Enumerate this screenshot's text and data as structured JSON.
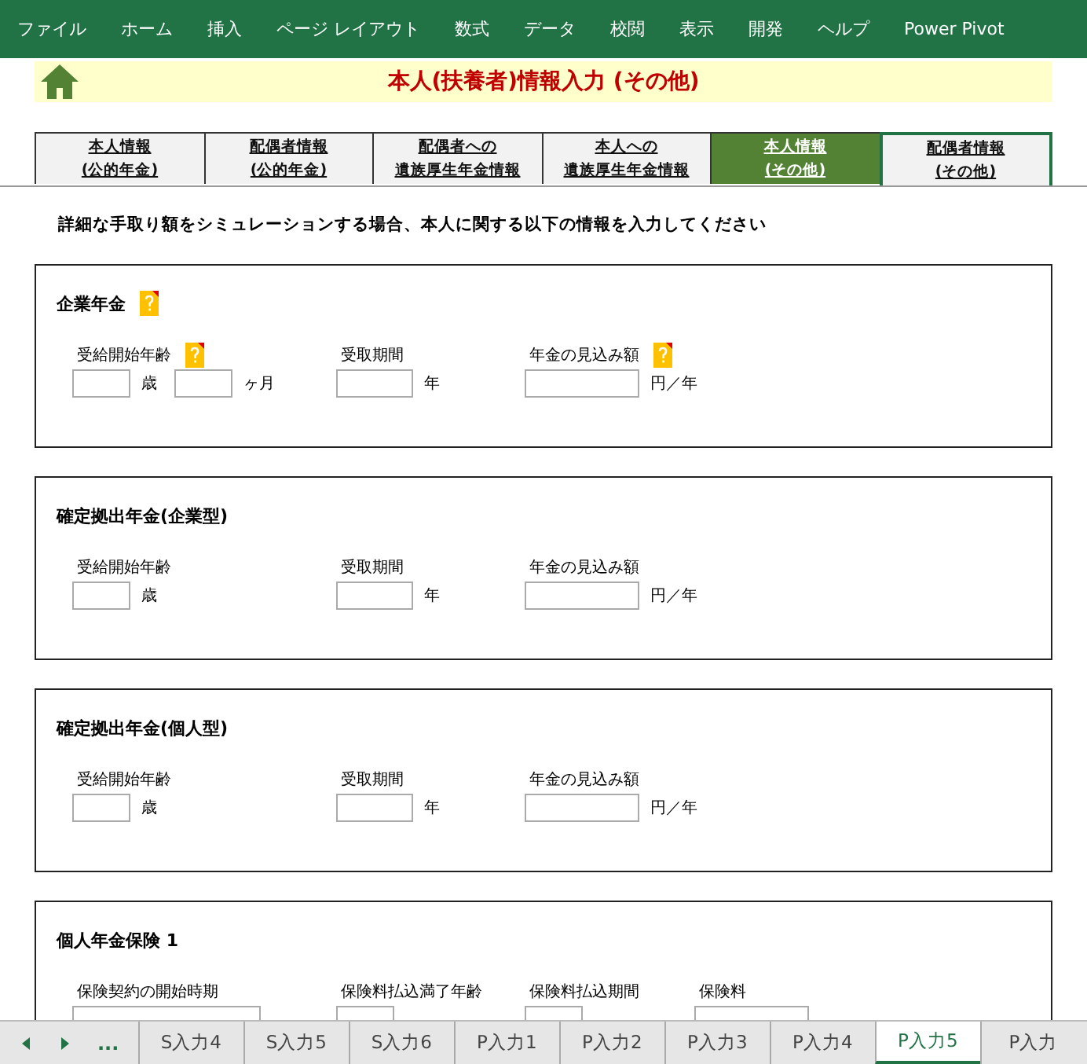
{
  "ribbon": [
    "ファイル",
    "ホーム",
    "挿入",
    "ページ レイアウト",
    "数式",
    "データ",
    "校閲",
    "表示",
    "開発",
    "ヘルプ",
    "Power Pivot"
  ],
  "banner": {
    "title": "本人(扶養者)情報入力 (その他)"
  },
  "tabs": [
    {
      "lines": [
        "本人情報",
        "(公的年金)"
      ],
      "selected": false
    },
    {
      "lines": [
        "配偶者情報",
        "(公的年金)"
      ],
      "selected": false
    },
    {
      "lines": [
        "配偶者への",
        "遺族厚生年金情報"
      ],
      "selected": false
    },
    {
      "lines": [
        "本人への",
        "遺族厚生年金情報"
      ],
      "selected": false
    },
    {
      "lines": [
        "本人情報",
        "(その他)"
      ],
      "selected": true
    },
    {
      "lines": [
        "配偶者情報",
        "(その他)"
      ],
      "selected": false
    }
  ],
  "intro": "詳細な手取り額をシミュレーションする場合、本人に関する以下の情報を入力してください",
  "sections": [
    {
      "title": "企業年金",
      "help": true,
      "fields": [
        {
          "label": "受給開始年齢",
          "help": true,
          "inputs": [
            {
              "kind": "short",
              "unit": "歳"
            },
            {
              "kind": "short",
              "unit": "ヶ月"
            }
          ]
        },
        {
          "label": "受取期間",
          "help": false,
          "inputs": [
            {
              "kind": "medium",
              "unit": "年"
            }
          ]
        },
        {
          "label": "年金の見込み額",
          "help": true,
          "inputs": [
            {
              "kind": "long",
              "unit": "円／年"
            }
          ]
        }
      ]
    },
    {
      "title": "確定拠出年金(企業型)",
      "help": false,
      "fields": [
        {
          "label": "受給開始年齢",
          "help": false,
          "inputs": [
            {
              "kind": "short",
              "unit": "歳"
            }
          ]
        },
        {
          "label": "受取期間",
          "help": false,
          "inputs": [
            {
              "kind": "medium",
              "unit": "年"
            }
          ]
        },
        {
          "label": "年金の見込み額",
          "help": false,
          "inputs": [
            {
              "kind": "long",
              "unit": "円／年"
            }
          ]
        }
      ]
    },
    {
      "title": "確定拠出年金(個人型)",
      "help": false,
      "fields": [
        {
          "label": "受給開始年齢",
          "help": false,
          "inputs": [
            {
              "kind": "short",
              "unit": "歳"
            }
          ]
        },
        {
          "label": "受取期間",
          "help": false,
          "inputs": [
            {
              "kind": "medium",
              "unit": "年"
            }
          ]
        },
        {
          "label": "年金の見込み額",
          "help": false,
          "inputs": [
            {
              "kind": "long",
              "unit": "円／年"
            }
          ]
        }
      ]
    },
    {
      "title": "個人年金保険 1",
      "help": false,
      "fields": [
        {
          "label": "保険契約の開始時期",
          "help": false,
          "inputs": [
            {
              "kind": "wide"
            }
          ]
        },
        {
          "label": "保険料払込満了年齢",
          "help": false,
          "inputs": [
            {
              "kind": "short"
            }
          ]
        },
        {
          "label": "保険料払込期間",
          "help": false,
          "inputs": [
            {
              "kind": "short"
            }
          ]
        },
        {
          "label": "保険料",
          "help": false,
          "inputs": [
            {
              "kind": "long"
            }
          ]
        }
      ]
    }
  ],
  "sheet_tabs": [
    {
      "label": "S入力4",
      "selected": false
    },
    {
      "label": "S入力5",
      "selected": false
    },
    {
      "label": "S入力6",
      "selected": false
    },
    {
      "label": "P入力1",
      "selected": false
    },
    {
      "label": "P入力2",
      "selected": false
    },
    {
      "label": "P入力3",
      "selected": false
    },
    {
      "label": "P入力4",
      "selected": false
    },
    {
      "label": "P入力5",
      "selected": true
    },
    {
      "label": "P入力",
      "selected": false
    }
  ],
  "sheet_nav": {
    "more": "..."
  }
}
